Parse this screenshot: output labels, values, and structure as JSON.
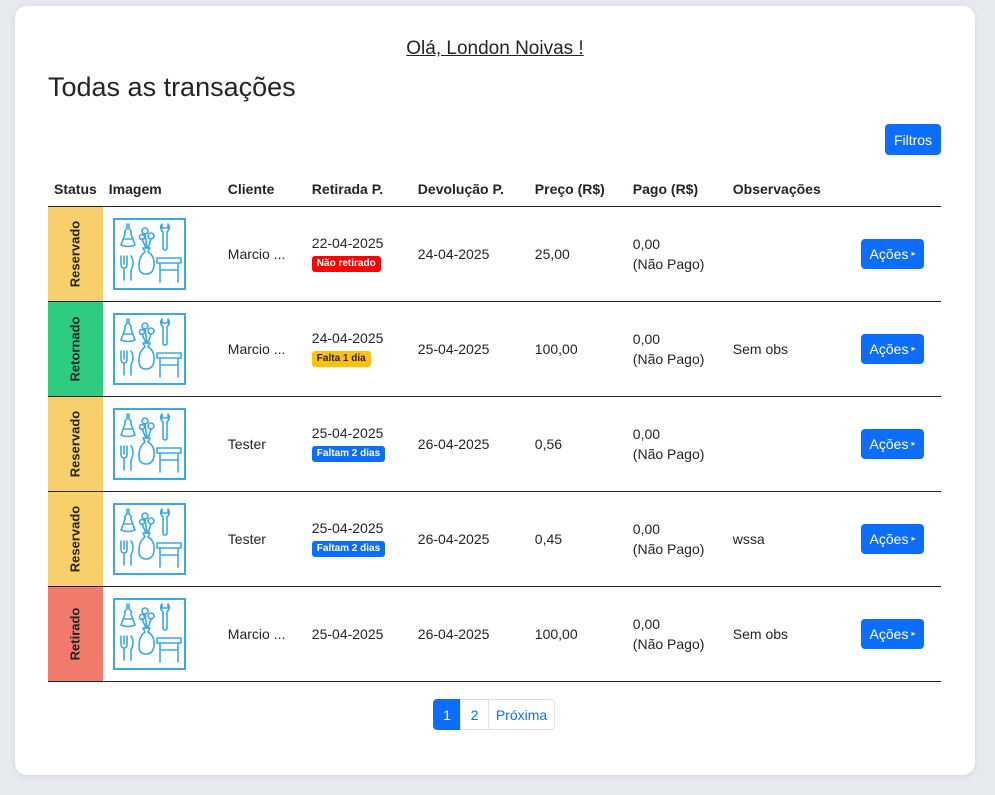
{
  "header": {
    "greeting": "Olá, London Noivas !",
    "title": "Todas as transações",
    "filter_label": "Filtros"
  },
  "table": {
    "columns": [
      "Status",
      "Imagem",
      "Cliente",
      "Retirada P.",
      "Devolução P.",
      "Preço (R$)",
      "Pago (R$)",
      "Observações"
    ],
    "rows": [
      {
        "status": "Reservado",
        "status_color": "#f7d06b",
        "cliente": "Marcio ...",
        "retirada": "22-04-2025",
        "badge": "Não retirado",
        "badge_type": "red",
        "devolucao": "24-04-2025",
        "preco": "25,00",
        "pago": "0,00",
        "pago_status": "(Não Pago)",
        "obs": "",
        "acao": "Ações"
      },
      {
        "status": "Retornado",
        "status_color": "#2ecc80",
        "cliente": "Marcio ...",
        "retirada": "24-04-2025",
        "badge": "Falta 1 dia",
        "badge_type": "yellow",
        "devolucao": "25-04-2025",
        "preco": "100,00",
        "pago": "0,00",
        "pago_status": "(Não Pago)",
        "obs": "Sem obs",
        "acao": "Ações"
      },
      {
        "status": "Reservado",
        "status_color": "#f7d06b",
        "cliente": "Tester",
        "retirada": "25-04-2025",
        "badge": "Faltam 2 dias",
        "badge_type": "blue",
        "devolucao": "26-04-2025",
        "preco": "0,56",
        "pago": "0,00",
        "pago_status": "(Não Pago)",
        "obs": "",
        "acao": "Ações"
      },
      {
        "status": "Reservado",
        "status_color": "#f7d06b",
        "cliente": "Tester",
        "retirada": "25-04-2025",
        "badge": "Faltam 2 dias",
        "badge_type": "blue",
        "devolucao": "26-04-2025",
        "preco": "0,45",
        "pago": "0,00",
        "pago_status": "(Não Pago)",
        "obs": "wssa",
        "acao": "Ações"
      },
      {
        "status": "Retirado",
        "status_color": "#f07b6d",
        "cliente": "Marcio ...",
        "retirada": "25-04-2025",
        "badge": "",
        "badge_type": "",
        "devolucao": "26-04-2025",
        "preco": "100,00",
        "pago": "0,00",
        "pago_status": "(Não Pago)",
        "obs": "Sem obs",
        "acao": "Ações"
      }
    ]
  },
  "pagination": {
    "pages": [
      "1",
      "2"
    ],
    "active": "1",
    "next_label": "Próxima"
  },
  "icons": {
    "thumbnail": "rental-items-icon",
    "caret": "caret-right-icon"
  },
  "colors": {
    "primary": "#0d6efd",
    "thumb_stroke": "#3aa9e8"
  }
}
